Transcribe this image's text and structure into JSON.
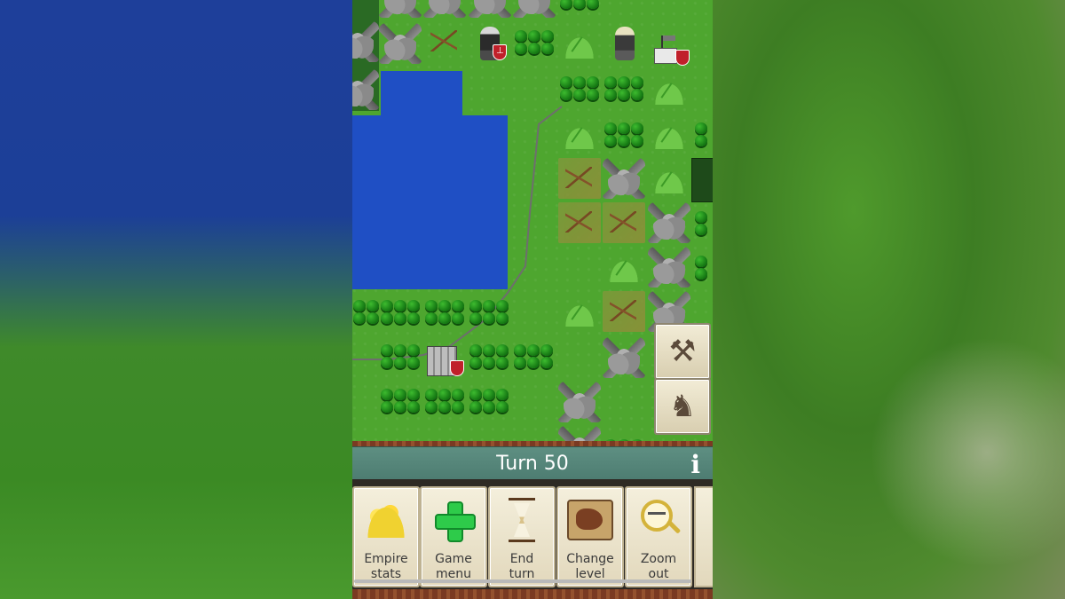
{
  "turn_bar": {
    "title": "Turn 50",
    "info_label": "i"
  },
  "side_buttons": [
    {
      "name": "build-tools-button",
      "icon": "tools-icon"
    },
    {
      "name": "army-button",
      "icon": "army-icon"
    }
  ],
  "toolbar": {
    "buttons": [
      {
        "line1": "Empire",
        "line2": "stats",
        "icon": "gold-pile-icon"
      },
      {
        "line1": "Game",
        "line2": "menu",
        "icon": "green-cross-icon"
      },
      {
        "line1": "End",
        "line2": "turn",
        "icon": "hourglass-icon"
      },
      {
        "line1": "Change",
        "line2": "level",
        "icon": "map-icon"
      },
      {
        "line1": "Zoom",
        "line2": "out",
        "icon": "magnifier-minus-icon"
      }
    ]
  },
  "colors": {
    "water": "#1f4fc4",
    "grass": "#4ea62f",
    "turnbar": "#5e8f82",
    "faction_shield": "#c0202a"
  }
}
